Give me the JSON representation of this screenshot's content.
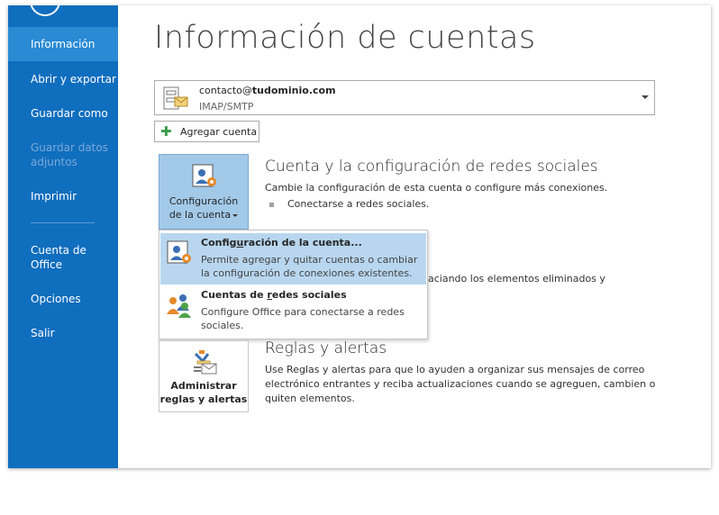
{
  "sidebar": {
    "items": [
      {
        "label": "Información",
        "state": "active"
      },
      {
        "label": "Abrir y exportar",
        "state": "normal"
      },
      {
        "label": "Guardar como",
        "state": "normal"
      },
      {
        "label": "Guardar datos",
        "label2": "adjuntos",
        "state": "disabled"
      },
      {
        "label": "Imprimir",
        "state": "normal"
      },
      {
        "label": "Cuenta de",
        "label2": "Office",
        "state": "normal"
      },
      {
        "label": "Opciones",
        "state": "normal"
      },
      {
        "label": "Salir",
        "state": "normal"
      }
    ]
  },
  "page": {
    "title": "Información de cuentas"
  },
  "account": {
    "email_user": "contacto@",
    "email_domain": "tudominio.com",
    "type": "IMAP/SMTP",
    "add_label": "Agregar cuenta"
  },
  "config_button": {
    "line1": "Configuración",
    "line2": "de la cuenta"
  },
  "social_section": {
    "title": "Cuenta y la configuración de redes sociales",
    "text": "Cambie la configuración de esta cuenta o configure más conexiones.",
    "bullet": "Conectarse a redes sociales."
  },
  "hidden_section": {
    "fragment": "aciando los elementos eliminados y"
  },
  "menu": {
    "item1": {
      "title_pre": "Config",
      "title_u": "u",
      "title_post": "ración de la cuenta...",
      "desc1": "Permite agregar y quitar cuentas o cambiar",
      "desc2": "la configuración de conexiones existentes."
    },
    "item2": {
      "title_pre": "Cuentas de ",
      "title_u": "r",
      "title_post": "edes sociales",
      "desc1": "Configure Office para conectarse a redes",
      "desc2": "sociales."
    }
  },
  "rules_button": {
    "line1": "Administrar",
    "line2": "reglas y alertas"
  },
  "rules_section": {
    "title": "Reglas y alertas",
    "line1": "Use Reglas y alertas para que lo ayuden a organizar sus mensajes de correo",
    "line2": "electrónico entrantes y reciba actualizaciones cuando se agreguen, cambien o",
    "line3": "quiten elementos."
  },
  "colors": {
    "sidebar": "#106ebe",
    "sidebar_active": "#2a8ad4",
    "menu_highlight": "#b8d6ef"
  }
}
